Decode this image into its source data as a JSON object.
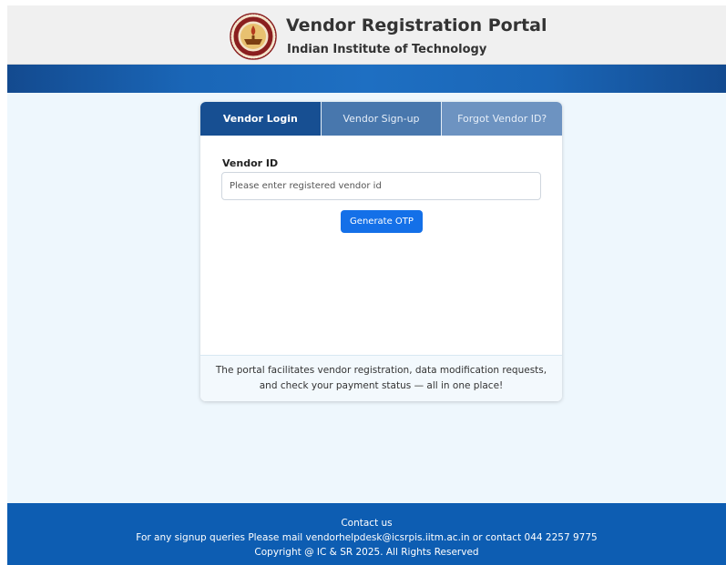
{
  "header": {
    "title": "Vendor Registration Portal",
    "subtitle": "Indian Institute of Technology",
    "logo_icon": "institute-seal-logo"
  },
  "tabs": [
    {
      "label": "Vendor Login",
      "active": true
    },
    {
      "label": "Vendor Sign-up",
      "active": false
    },
    {
      "label": "Forgot Vendor ID?",
      "active": false
    }
  ],
  "login": {
    "field_label": "Vendor ID",
    "placeholder": "Please enter registered vendor id",
    "value": "",
    "button_label": "Generate OTP"
  },
  "info": {
    "line1": "The portal facilitates vendor registration, data modification requests,",
    "line2": "and check your payment status — all in one place!"
  },
  "footer": {
    "contact_heading": "Contact us",
    "contact_line": "For any signup queries Please mail vendorhelpdesk@icsrpis.iitm.ac.in or contact 044 2257 9775",
    "copyright": "Copyright @ IC & SR 2025. All Rights Reserved"
  },
  "colors": {
    "header_bg": "#f0f0f0",
    "band_blue": "#1a66b7",
    "tab_active": "#174f92",
    "tab_inactive": "#4877ad",
    "button_blue": "#1470e8",
    "footer_blue": "#0d5db2",
    "page_bg": "#eef7fd"
  }
}
